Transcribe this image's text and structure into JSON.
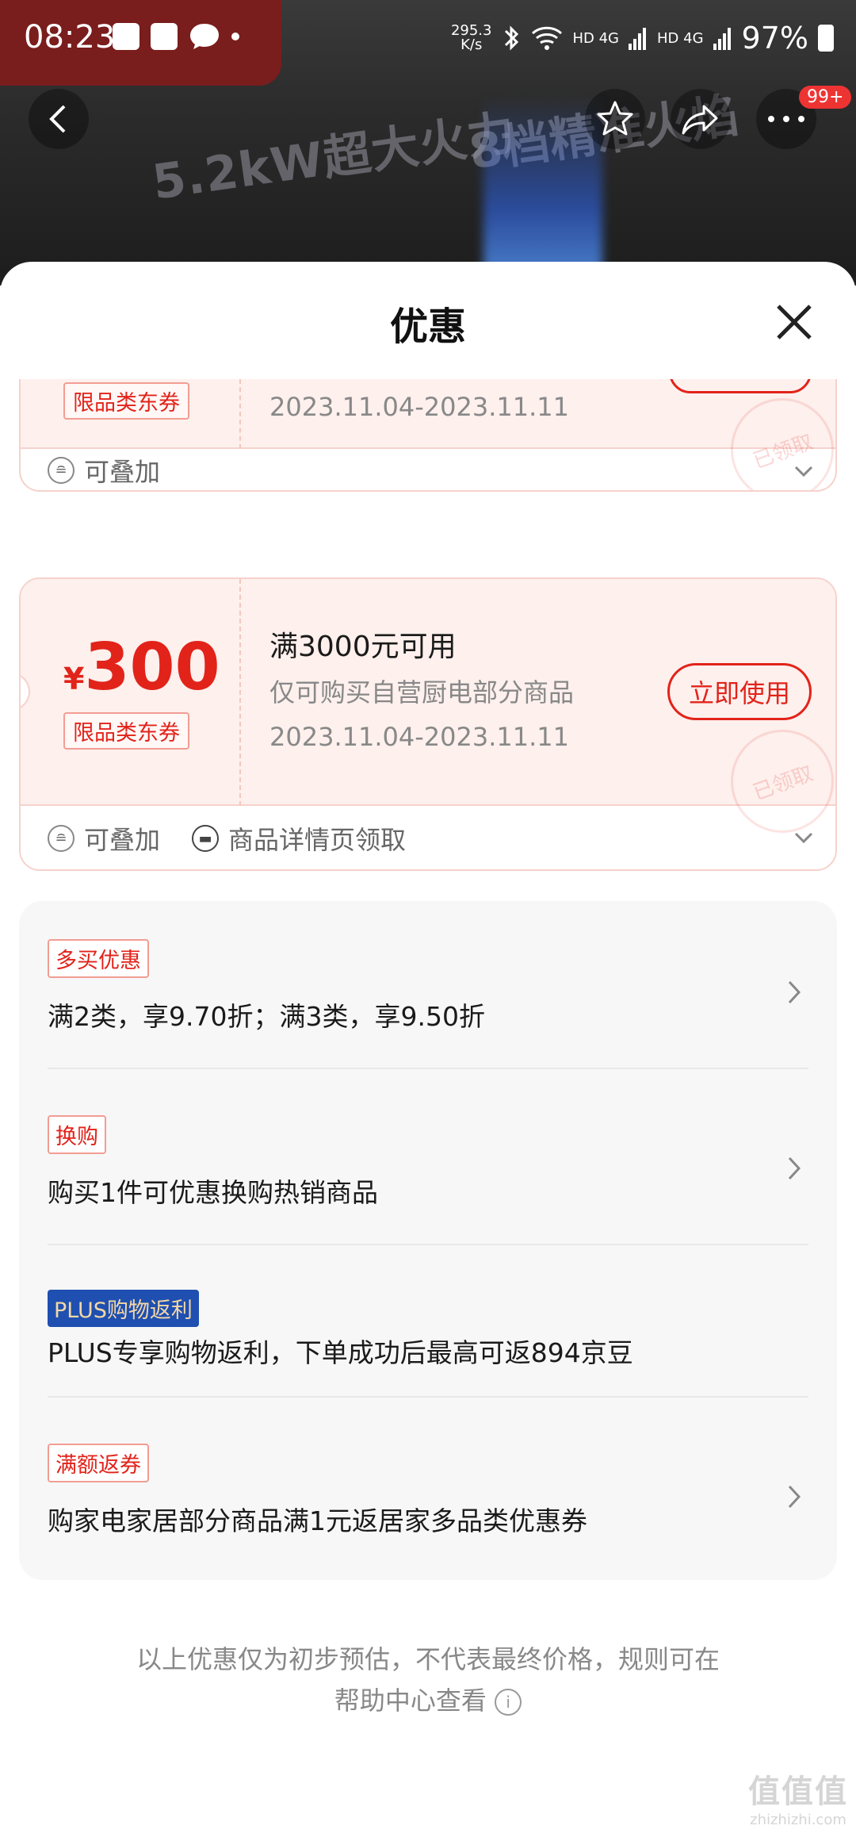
{
  "status_bar": {
    "time": "08:23",
    "net_speed": "295.3\nK/s",
    "signal_1": "HD 4G",
    "signal_2": "HD 4G",
    "battery": "97%"
  },
  "banner": {
    "text_1": "5.2kW超大火力",
    "text_2": "8档精准火焰",
    "notification_badge": "99+"
  },
  "sheet": {
    "title": "优惠"
  },
  "coupons": [
    {
      "category_tag": "限品类东券",
      "date_range": "2023.11.04-2023.11.11",
      "stamp": "已领取",
      "footer": [
        {
          "icon": "stack-icon",
          "label": "可叠加"
        }
      ]
    },
    {
      "currency": "¥",
      "amount": "300",
      "category_tag": "限品类东券",
      "condition": "满3000元可用",
      "scope": "仅可购买自营厨电部分商品",
      "date_range": "2023.11.04-2023.11.11",
      "button": "立即使用",
      "stamp": "已领取",
      "footer": [
        {
          "icon": "stack-icon",
          "label": "可叠加"
        },
        {
          "icon": "ticket-icon",
          "label": "商品详情页领取"
        }
      ]
    }
  ],
  "promotions": [
    {
      "tag": "多买优惠",
      "text": "满2类，享9.70折；满3类，享9.50折",
      "has_arrow": true
    },
    {
      "tag": "换购",
      "text": "购买1件可优惠换购热销商品",
      "has_arrow": true
    },
    {
      "tag": "PLUS购物返利",
      "text": "PLUS专享购物返利，下单成功后最高可返894京豆",
      "has_arrow": false
    },
    {
      "tag": "满额返券",
      "text": "购家电家居部分商品满1元返居家多品类优惠券",
      "has_arrow": true
    }
  ],
  "disclaimer": {
    "line1": "以上优惠仅为初步预估，不代表最终价格，规则可在",
    "line2": "帮助中心查看"
  },
  "watermark": {
    "logo": "值值值",
    "url": "zhizhizhi.com"
  },
  "colors": {
    "accent_red": "#e2231a",
    "coupon_bg": "#fdf0ed",
    "plus_blue": "#1f4fb0"
  }
}
